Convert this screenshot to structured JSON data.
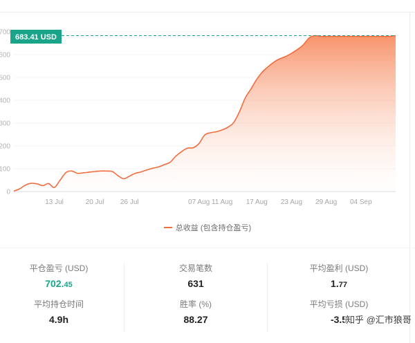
{
  "tooltip": {
    "label": "683.41 USD"
  },
  "chart_data": {
    "type": "area",
    "y_ticks": [
      "0",
      "100",
      "200",
      "300",
      "400",
      "500",
      "600",
      "700"
    ],
    "y_tick_values": [
      0,
      100,
      200,
      300,
      400,
      500,
      600,
      700
    ],
    "ylim": [
      0,
      700
    ],
    "x_tick_labels": [
      "13 Jul",
      "20 Jul",
      "26 Jul",
      "07 Aug",
      "11 Aug",
      "17 Aug",
      "23 Aug",
      "29 Aug",
      "04 Sep"
    ],
    "x_range": [
      "06 Jul",
      "10 Sep"
    ],
    "series": [
      {
        "name": "总收益 (包含持仓盈亏)",
        "x": [
          "06 Jul",
          "07 Jul",
          "08 Jul",
          "09 Jul",
          "10 Jul",
          "11 Jul",
          "12 Jul",
          "13 Jul",
          "14 Jul",
          "15 Jul",
          "16 Jul",
          "17 Jul",
          "18 Jul",
          "19 Jul",
          "20 Jul",
          "21 Jul",
          "22 Jul",
          "23 Jul",
          "24 Jul",
          "25 Jul",
          "26 Jul",
          "27 Jul",
          "28 Jul",
          "29 Jul",
          "30 Jul",
          "31 Jul",
          "01 Aug",
          "02 Aug",
          "03 Aug",
          "04 Aug",
          "05 Aug",
          "06 Aug",
          "07 Aug",
          "08 Aug",
          "09 Aug",
          "10 Aug",
          "11 Aug",
          "12 Aug",
          "13 Aug",
          "14 Aug",
          "15 Aug",
          "16 Aug",
          "17 Aug",
          "18 Aug",
          "19 Aug",
          "20 Aug",
          "21 Aug",
          "22 Aug",
          "23 Aug",
          "24 Aug",
          "25 Aug",
          "26 Aug",
          "27 Aug",
          "28 Aug",
          "29 Aug",
          "30 Aug",
          "31 Aug",
          "01 Sep",
          "02 Sep",
          "03 Sep",
          "04 Sep",
          "05 Sep",
          "06 Sep",
          "07 Sep",
          "08 Sep",
          "09 Sep",
          "10 Sep"
        ],
        "values": [
          2,
          12,
          28,
          36,
          34,
          26,
          35,
          18,
          50,
          83,
          90,
          80,
          82,
          85,
          88,
          90,
          90,
          88,
          70,
          56,
          68,
          80,
          86,
          95,
          102,
          108,
          118,
          128,
          155,
          175,
          190,
          192,
          210,
          248,
          258,
          262,
          270,
          282,
          302,
          350,
          410,
          450,
          492,
          525,
          548,
          568,
          582,
          592,
          606,
          622,
          642,
          672,
          683,
          680,
          680,
          680,
          680,
          680,
          680,
          680,
          680,
          680,
          680,
          680,
          680,
          680,
          683
        ]
      }
    ],
    "reference_line": {
      "value": 683.41,
      "style": "dashed"
    },
    "colors": {
      "line": "#f26b3c",
      "fill": "#f79870",
      "reference": "#1aa48a"
    },
    "grid": true,
    "legend_position": "bottom"
  },
  "legend": {
    "label": "总收益 (包含持仓盈亏)"
  },
  "stats": {
    "closed_pnl_label": "平仓盈亏 (USD)",
    "closed_pnl_int": "702.",
    "closed_pnl_dec": "45",
    "avg_hold_label": "平均持仓时间",
    "avg_hold_value": "4.9h",
    "trades_label": "交易笔数",
    "trades_value": "631",
    "winrate_label": "胜率 (%)",
    "winrate_value": "88.27",
    "avg_profit_label": "平均盈利 (USD)",
    "avg_profit_int": "1.",
    "avg_profit_dec": "77",
    "avg_loss_label": "平均亏损 (USD)",
    "avg_loss_value": "-3.5"
  },
  "watermark": {
    "text": "知乎 @汇市狼哥"
  }
}
